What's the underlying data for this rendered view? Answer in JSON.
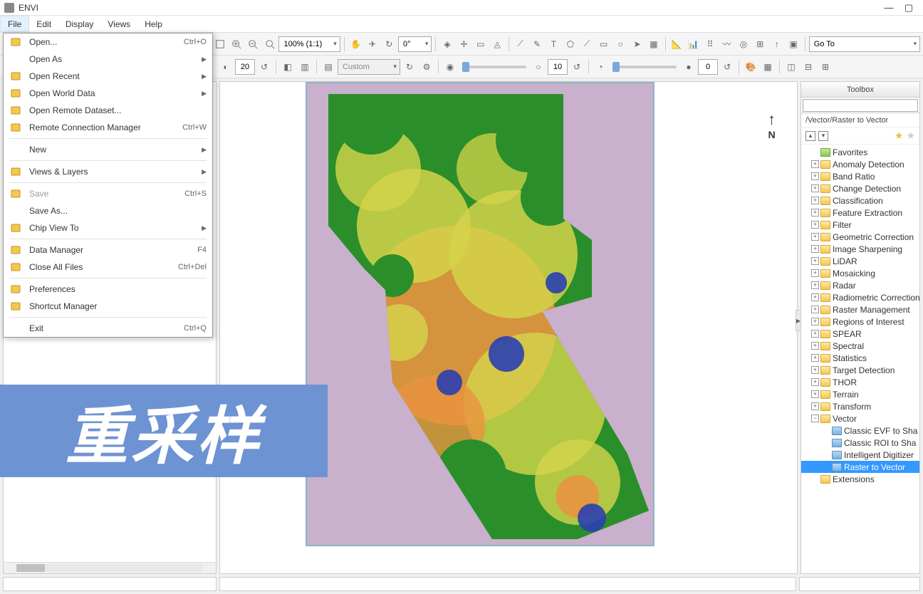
{
  "app": {
    "title": "ENVI"
  },
  "menubar": [
    "File",
    "Edit",
    "Display",
    "Views",
    "Help"
  ],
  "filemenu": [
    {
      "label": "Open...",
      "shortcut": "Ctrl+O",
      "icon": "folder-open"
    },
    {
      "label": "Open As",
      "arrow": true
    },
    {
      "label": "Open Recent",
      "arrow": true,
      "icon": "folder-recent"
    },
    {
      "label": "Open World Data",
      "arrow": true,
      "icon": "globe"
    },
    {
      "label": "Open Remote Dataset...",
      "icon": "remote"
    },
    {
      "label": "Remote Connection Manager",
      "shortcut": "Ctrl+W",
      "icon": "connection"
    },
    {
      "sep": true
    },
    {
      "label": "New",
      "arrow": true
    },
    {
      "sep": true
    },
    {
      "label": "Views & Layers",
      "arrow": true,
      "icon": "layers"
    },
    {
      "sep": true
    },
    {
      "label": "Save",
      "shortcut": "Ctrl+S",
      "disabled": true,
      "icon": "save"
    },
    {
      "label": "Save As..."
    },
    {
      "label": "Chip View To",
      "arrow": true,
      "icon": "chip"
    },
    {
      "sep": true
    },
    {
      "label": "Data Manager",
      "shortcut": "F4",
      "icon": "data"
    },
    {
      "label": "Close All Files",
      "shortcut": "Ctrl+Del",
      "icon": "close-all"
    },
    {
      "sep": true
    },
    {
      "label": "Preferences",
      "icon": "wrench"
    },
    {
      "label": "Shortcut Manager",
      "icon": "keyboard"
    },
    {
      "sep": true
    },
    {
      "label": "Exit",
      "shortcut": "Ctrl+Q"
    }
  ],
  "toolbar1": {
    "zoom_combo": "100% (1:1)",
    "rotate_value": "0°",
    "goto": "Go To"
  },
  "toolbar2": {
    "brightness": "20",
    "stretch_combo": "Custom",
    "sharpen": "10",
    "transparency": "0"
  },
  "toolbox": {
    "title": "Toolbox",
    "search_placeholder": "",
    "crumb": "/Vector/Raster to Vector",
    "nodes": [
      {
        "label": "Favorites",
        "type": "fav",
        "depth": 1
      },
      {
        "label": "Anomaly Detection",
        "type": "folder",
        "depth": 1,
        "exp": "+"
      },
      {
        "label": "Band Ratio",
        "type": "folder",
        "depth": 1,
        "exp": "+"
      },
      {
        "label": "Change Detection",
        "type": "folder",
        "depth": 1,
        "exp": "+"
      },
      {
        "label": "Classification",
        "type": "folder",
        "depth": 1,
        "exp": "+"
      },
      {
        "label": "Feature Extraction",
        "type": "folder",
        "depth": 1,
        "exp": "+"
      },
      {
        "label": "Filter",
        "type": "folder",
        "depth": 1,
        "exp": "+"
      },
      {
        "label": "Geometric Correction",
        "type": "folder",
        "depth": 1,
        "exp": "+"
      },
      {
        "label": "Image Sharpening",
        "type": "folder",
        "depth": 1,
        "exp": "+"
      },
      {
        "label": "LiDAR",
        "type": "folder",
        "depth": 1,
        "exp": "+"
      },
      {
        "label": "Mosaicking",
        "type": "folder",
        "depth": 1,
        "exp": "+"
      },
      {
        "label": "Radar",
        "type": "folder",
        "depth": 1,
        "exp": "+"
      },
      {
        "label": "Radiometric Correction",
        "type": "folder",
        "depth": 1,
        "exp": "+"
      },
      {
        "label": "Raster Management",
        "type": "folder",
        "depth": 1,
        "exp": "+"
      },
      {
        "label": "Regions of Interest",
        "type": "folder",
        "depth": 1,
        "exp": "+"
      },
      {
        "label": "SPEAR",
        "type": "folder",
        "depth": 1,
        "exp": "+"
      },
      {
        "label": "Spectral",
        "type": "folder",
        "depth": 1,
        "exp": "+"
      },
      {
        "label": "Statistics",
        "type": "folder",
        "depth": 1,
        "exp": "+"
      },
      {
        "label": "Target Detection",
        "type": "folder",
        "depth": 1,
        "exp": "+"
      },
      {
        "label": "THOR",
        "type": "folder",
        "depth": 1,
        "exp": "+"
      },
      {
        "label": "Terrain",
        "type": "folder",
        "depth": 1,
        "exp": "+"
      },
      {
        "label": "Transform",
        "type": "folder",
        "depth": 1,
        "exp": "+"
      },
      {
        "label": "Vector",
        "type": "folder",
        "depth": 1,
        "exp": "−"
      },
      {
        "label": "Classic EVF to Sha",
        "type": "tool",
        "depth": 2
      },
      {
        "label": "Classic ROI to Sha",
        "type": "tool",
        "depth": 2
      },
      {
        "label": "Intelligent Digitizer",
        "type": "tool",
        "depth": 2
      },
      {
        "label": "Raster to Vector",
        "type": "tool",
        "depth": 2,
        "sel": true
      },
      {
        "label": "Extensions",
        "type": "folder",
        "depth": 1
      }
    ]
  },
  "overlay_text": "重采样",
  "colors": {
    "accent": "#3399ff",
    "map_bg": "#c9b0cc",
    "forest": "#2a8f2a",
    "grass": "#d4d44a",
    "urban": "#e89440",
    "water": "#2a3fb0"
  }
}
